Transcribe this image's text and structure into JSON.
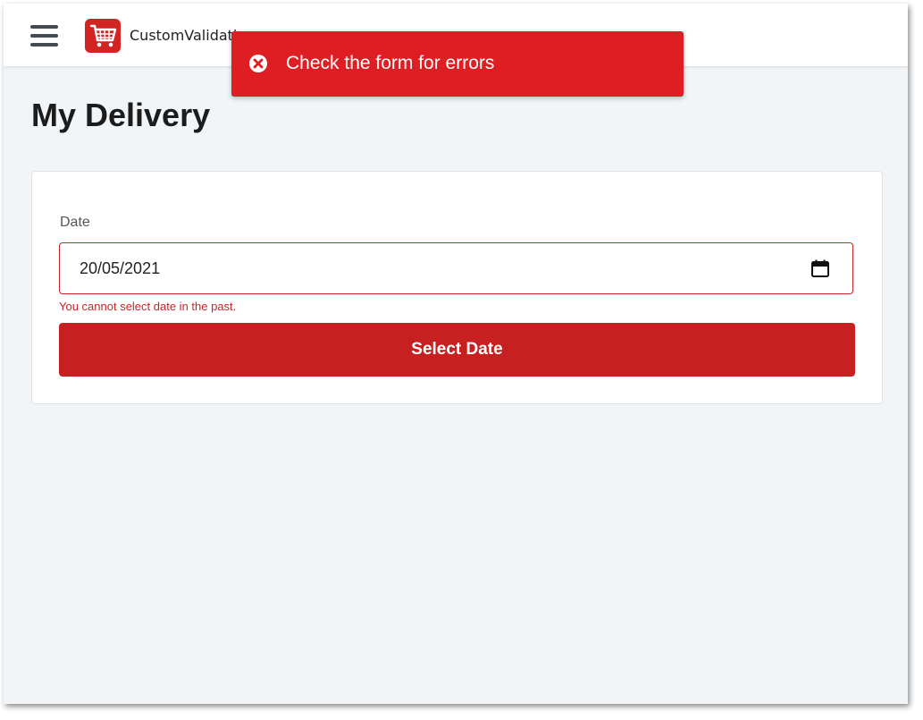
{
  "header": {
    "app_title": "CustomValidati",
    "logo_icon": "shopping-cart-icon",
    "menu_icon": "hamburger-menu-icon"
  },
  "toast": {
    "message": "Check the form for errors",
    "icon": "error-circle-x-icon",
    "color": "#de1e22"
  },
  "page": {
    "title": "My Delivery"
  },
  "form": {
    "date_label": "Date",
    "date_value": "20/05/2021",
    "calendar_icon": "calendar-icon",
    "error_message": "You cannot select date in the past.",
    "submit_label": "Select Date"
  },
  "colors": {
    "accent": "#c62020",
    "error": "#c7252a",
    "background": "#f2f5f8"
  }
}
